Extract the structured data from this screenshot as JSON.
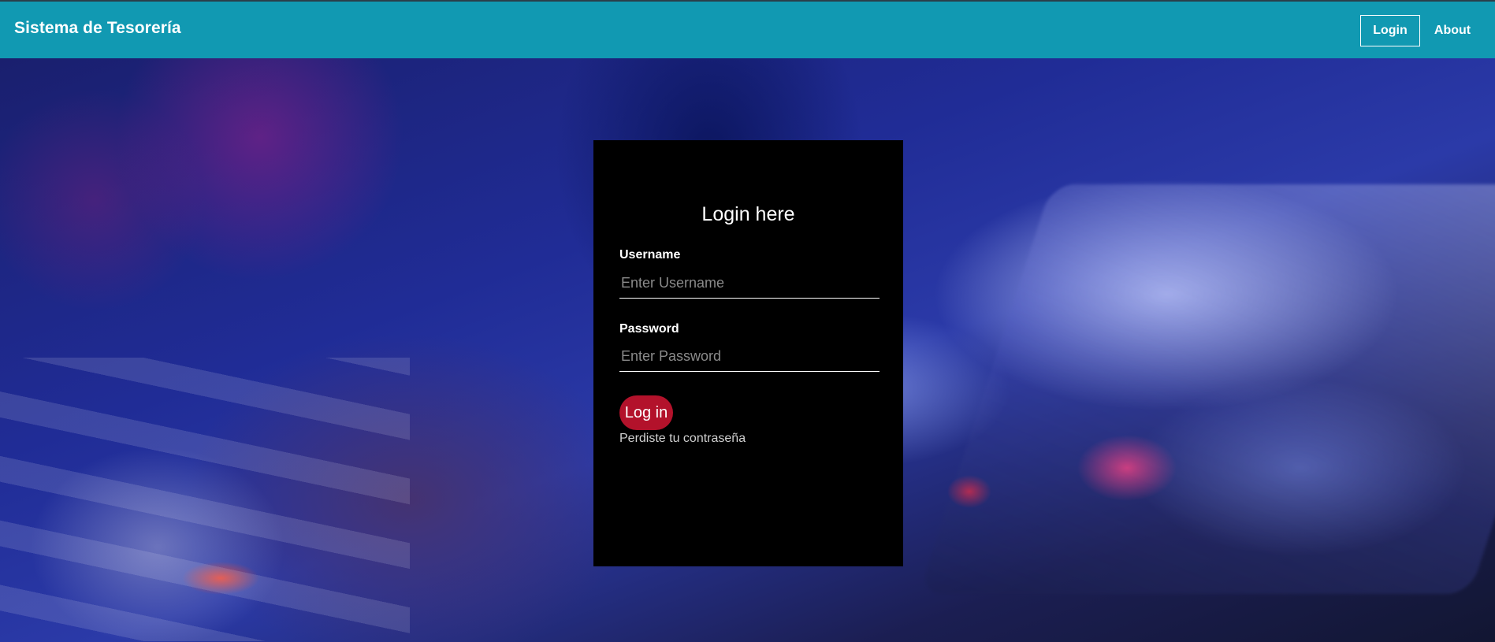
{
  "navbar": {
    "brand": "Sistema de Tesorería",
    "links": [
      {
        "label": "Login"
      },
      {
        "label": "About"
      }
    ]
  },
  "login_form": {
    "title": "Login here",
    "username_label": "Username",
    "username_placeholder": "Enter Username",
    "username_value": "",
    "password_label": "Password",
    "password_placeholder": "Enter Password",
    "password_value": "",
    "submit_label": "Log in",
    "forgot_password_link": "Perdiste tu contraseña"
  },
  "colors": {
    "navbar_background": "#1199b2",
    "card_background": "#000000",
    "button_background": "#b3122b",
    "text": "#ffffff"
  }
}
